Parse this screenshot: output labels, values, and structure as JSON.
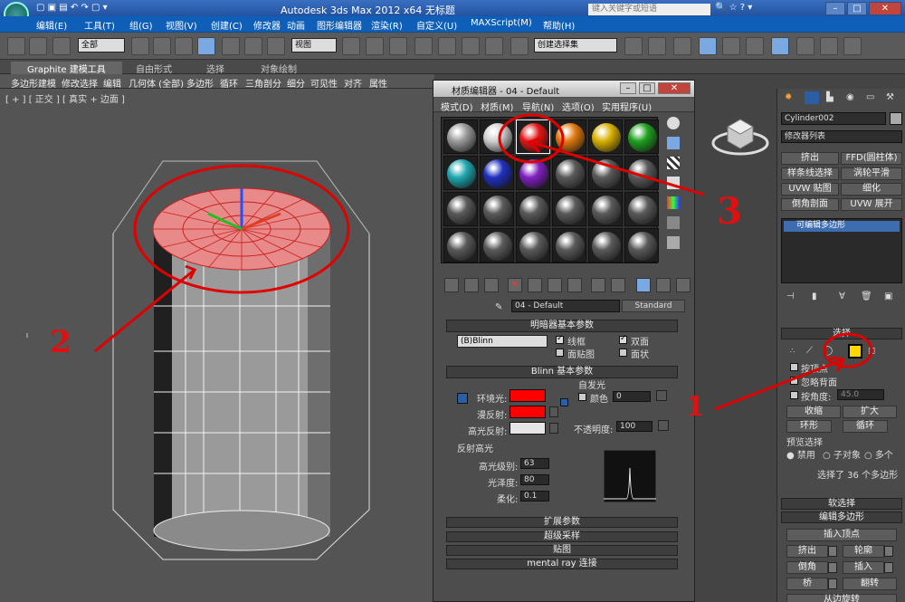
{
  "titlebar": {
    "title": "Autodesk 3ds Max  2012 x64      无标题",
    "search_placeholder": "键入关键字或短语"
  },
  "menubar": {
    "items": [
      "编辑(E)",
      "工具(T)",
      "组(G)",
      "视图(V)",
      "创建(C)",
      "修改器",
      "动画",
      "图形编辑器",
      "渲染(R)",
      "自定义(U)",
      "MAXScript(M)",
      "帮助(H)"
    ]
  },
  "toolbar": {
    "selection_filter": "全部",
    "ref_coord": "视图",
    "named_selection": "创建选择集"
  },
  "ribbon": {
    "tabs": [
      "Graphite 建模工具",
      "自由形式",
      "选择",
      "对象绘制"
    ],
    "buttons": [
      "多边形建模",
      "修改选择",
      "编辑",
      "几何体 (全部)",
      "多边形",
      "循环",
      "三角剖分",
      "细分",
      "可见性",
      "对齐",
      "属性"
    ]
  },
  "viewport": {
    "label": "[ + ] [ 正交 ] [ 真实 + 边面 ]"
  },
  "material_editor": {
    "title": "材质编辑器 - 04 - Default",
    "menu": [
      "模式(D)",
      "材质(M)",
      "导航(N)",
      "选项(O)",
      "实用程序(U)"
    ],
    "material_name": "04 - Default",
    "material_type": "Standard",
    "shader_rollout": "明暗器基本参数",
    "shader": "(B)Blinn",
    "wire": "线框",
    "two_sided": "双面",
    "face_map": "面贴图",
    "faceted": "面状",
    "blinn_rollout": "Blinn 基本参数",
    "self_illum": "自发光",
    "color_label": "颜色",
    "color_value": "0",
    "ambient": "环境光:",
    "diffuse": "漫反射:",
    "specular": "高光反射:",
    "opacity_label": "不透明度:",
    "opacity_value": "100",
    "spec_highlights": "反射高光",
    "spec_level_label": "高光级别:",
    "spec_level": "63",
    "gloss_label": "光泽度:",
    "gloss": "80",
    "soften_label": "柔化:",
    "soften": "0.1",
    "rollouts": [
      "扩展参数",
      "超级采样",
      "贴图",
      "mental ray 连接"
    ],
    "colors": {
      "ambient": "#ff0000",
      "diffuse": "#ff0000",
      "specular": "#e5e5e5"
    }
  },
  "command_panel": {
    "object_name": "Cylinder002",
    "modifier_list": "修改器列表",
    "buttons": [
      "挤出",
      "FFD(圆柱体)",
      "样条线选择",
      "涡轮平滑",
      "UVW 贴图",
      "细化",
      "倒角剖面",
      "UVW 展开"
    ],
    "stack_item": "可编辑多边形",
    "selection_rollout": "选择",
    "by_vertex": "按顶点",
    "ignore_backfacing": "忽略背面",
    "by_angle": "按角度:",
    "angle_value": "45.0",
    "shrink": "收缩",
    "grow": "扩大",
    "ring": "环形",
    "loop": "循环",
    "preview_selection": "预览选择",
    "disabled": "禁用",
    "subobject": "子对象",
    "multi": "多个",
    "selected_info": "选择了 36 个多边形",
    "soft_selection": "软选择",
    "edit_polygons": "编辑多边形",
    "insert_vertex": "插入顶点",
    "extrude": "挤出",
    "outline": "轮廓",
    "bevel": "倒角",
    "inset": "插入",
    "bridge": "桥",
    "flip": "翻转",
    "hinge": "从边旋转"
  },
  "annotations": [
    "1",
    "2",
    "3"
  ]
}
